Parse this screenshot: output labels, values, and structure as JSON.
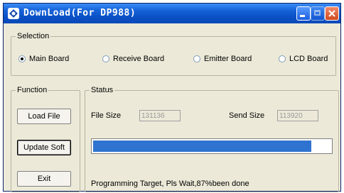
{
  "window": {
    "title": "DownLoad(For DP988)"
  },
  "selection": {
    "legend": "Selection",
    "options": [
      {
        "label": "Main Board",
        "selected": true
      },
      {
        "label": "Receive Board",
        "selected": false
      },
      {
        "label": "Emitter Board",
        "selected": false
      },
      {
        "label": "LCD Board",
        "selected": false
      }
    ]
  },
  "function": {
    "legend": "Function",
    "load_file": "Load File",
    "update_soft": "Update Soft",
    "exit": "Exit"
  },
  "status": {
    "legend": "Status",
    "file_size_label": "File Size",
    "file_size_value": "131136",
    "send_size_label": "Send Size",
    "send_size_value": "113920",
    "progress_fraction": 0.92,
    "message": "Programming Target, Pls Wait,87%been done"
  },
  "colors": {
    "titlebar": "#0a4fc4",
    "progress_fill": "#2f73d0"
  }
}
